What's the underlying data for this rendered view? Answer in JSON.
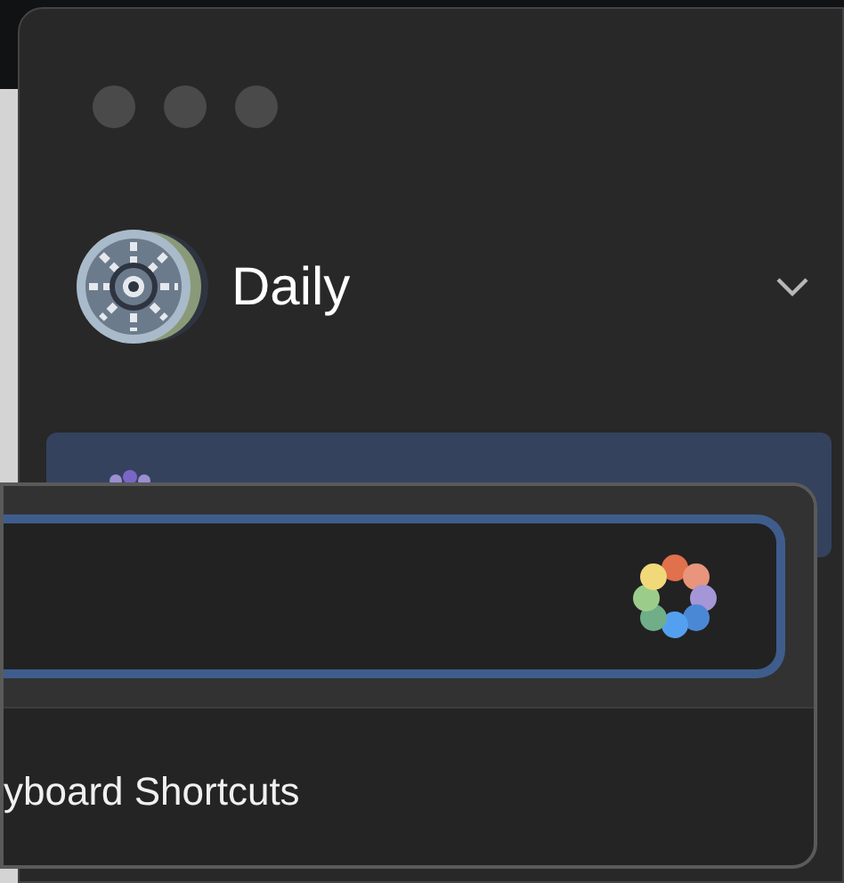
{
  "window": {
    "title": "Daily"
  },
  "sidebar": {
    "items": [
      {
        "selected": true
      }
    ]
  },
  "popup": {
    "search": {
      "focused": true
    },
    "menu_items": [
      {
        "label": "yboard Shortcuts"
      }
    ]
  }
}
